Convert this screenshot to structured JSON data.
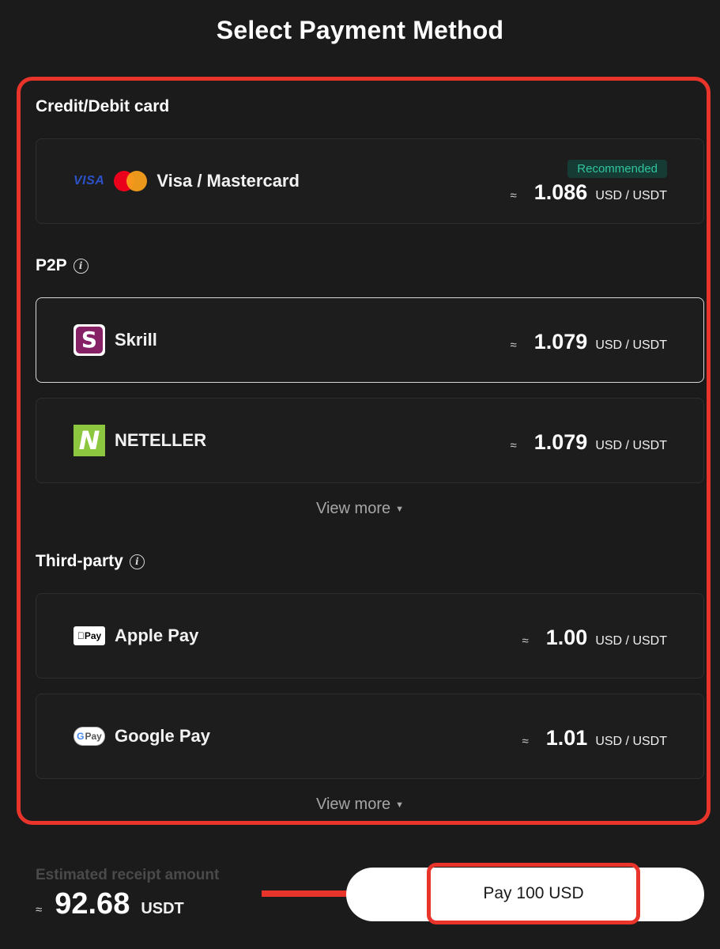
{
  "page": {
    "title": "Select Payment Method"
  },
  "sections": {
    "card": {
      "heading": "Credit/Debit card",
      "methods": [
        {
          "name": "Visa / Mastercard",
          "badge": "Recommended",
          "approx": "≈",
          "rate": "1.086",
          "unit": "USD / USDT",
          "logo_text": "VISA",
          "icon": "visa-mastercard-logo"
        }
      ]
    },
    "p2p": {
      "heading": "P2P",
      "methods": [
        {
          "name": "Skrill",
          "approx": "≈",
          "rate": "1.079",
          "unit": "USD / USDT",
          "logo_text": "S",
          "icon": "skrill-logo",
          "selected": true
        },
        {
          "name": "NETELLER",
          "approx": "≈",
          "rate": "1.079",
          "unit": "USD / USDT",
          "logo_text": "N",
          "icon": "neteller-logo"
        }
      ],
      "view_more": "View more"
    },
    "third_party": {
      "heading": "Third-party",
      "methods": [
        {
          "name": "Apple Pay",
          "approx": "≈",
          "rate": "1.00",
          "unit": "USD / USDT",
          "logo_text": "Pay",
          "icon": "apple-pay-logo"
        },
        {
          "name": "Google Pay",
          "approx": "≈",
          "rate": "1.01",
          "unit": "USD / USDT",
          "logo_text_g": "G",
          "logo_text": "Pay",
          "icon": "google-pay-logo"
        }
      ],
      "view_more": "View more"
    }
  },
  "footer": {
    "estimate_label": "Estimated receipt amount",
    "approx": "≈",
    "amount": "92.68",
    "currency": "USDT",
    "pay_button": "Pay 100 USD"
  },
  "colors": {
    "background": "#1b1b1b",
    "highlight": "#e8342a",
    "recommended_text": "#2fc59f",
    "recommended_bg": "#163a34",
    "skrill": "#862165",
    "neteller": "#8dc63f"
  }
}
